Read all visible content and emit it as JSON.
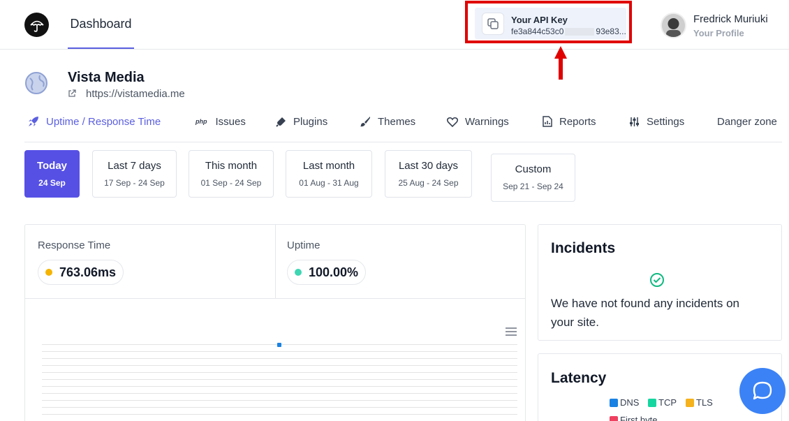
{
  "header": {
    "nav_dashboard": "Dashboard",
    "api_key_label": "Your API Key",
    "api_key_prefix": "fe3a844c53c0",
    "api_key_suffix": "93e83...",
    "user_name": "Fredrick Muriuki",
    "user_sub": "Your Profile"
  },
  "site": {
    "name": "Vista Media",
    "url": "https://vistamedia.me"
  },
  "tabs": [
    {
      "label": "Uptime / Response Time",
      "icon": "rocket-icon",
      "active": true
    },
    {
      "label": "Issues",
      "icon": "php-icon",
      "prefix": "php"
    },
    {
      "label": "Plugins",
      "icon": "plug-icon"
    },
    {
      "label": "Themes",
      "icon": "brush-icon"
    },
    {
      "label": "Warnings",
      "icon": "heart-icon"
    },
    {
      "label": "Reports",
      "icon": "report-icon"
    },
    {
      "label": "Settings",
      "icon": "sliders-icon"
    },
    {
      "label": "Danger zone"
    }
  ],
  "ranges": [
    {
      "title": "Today",
      "range": "24 Sep",
      "active": true
    },
    {
      "title": "Last 7 days",
      "range": "17 Sep - 24 Sep"
    },
    {
      "title": "This month",
      "range": "01 Sep - 24 Sep"
    },
    {
      "title": "Last month",
      "range": "01 Aug - 31 Aug"
    },
    {
      "title": "Last 30 days",
      "range": "25 Aug - 24 Sep"
    },
    {
      "title": "Custom",
      "range": "Sep 21 - Sep 24"
    }
  ],
  "stats": {
    "response_label": "Response Time",
    "response_value": "763.06ms",
    "uptime_label": "Uptime",
    "uptime_value": "100.00%",
    "response_color": "#f5b400",
    "uptime_color": "#3ed6b3"
  },
  "incidents": {
    "title": "Incidents",
    "message": "We have not found any incidents on your site."
  },
  "latency": {
    "title": "Latency",
    "legend": [
      {
        "label": "DNS",
        "color": "#1a82e2"
      },
      {
        "label": "TCP",
        "color": "#16d6a0"
      },
      {
        "label": "TLS",
        "color": "#f5b21c"
      },
      {
        "label": "First byte",
        "color": "#ef4060"
      }
    ]
  },
  "colors": {
    "accent": "#5b5fe0",
    "highlight_box": "#e00000",
    "chat": "#3b82f6"
  }
}
